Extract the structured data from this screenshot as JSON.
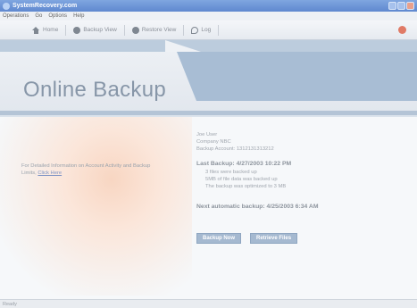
{
  "window": {
    "title": "SystemRecovery.com"
  },
  "menu": {
    "items": [
      "Operations",
      "Go",
      "Options",
      "Help"
    ]
  },
  "toolbar": {
    "home": "Home",
    "backup_view": "Backup View",
    "restore_view": "Restore View",
    "log": "Log"
  },
  "banner": {
    "title": "Online Backup"
  },
  "left_note": {
    "text": "For Detailed Information on Account Activity and Backup Limits,",
    "link": "Click Here"
  },
  "account": {
    "user": "Joe User",
    "company": "Company NBC",
    "account_label": "Backup Account:",
    "account_number": "1312131313212"
  },
  "last_backup": {
    "label": "Last Backup: 4/27/2003 10:22 PM",
    "lines": [
      "3 files were backed up",
      "5MB of file data was backed up",
      "The backup was optimized to 3 MB"
    ]
  },
  "next_backup": {
    "label": "Next automatic backup: 4/25/2003 6:34 AM"
  },
  "actions": {
    "backup_now": "Backup Now",
    "retrieve_files": "Retrieve Files"
  },
  "status": {
    "text": "Ready"
  }
}
